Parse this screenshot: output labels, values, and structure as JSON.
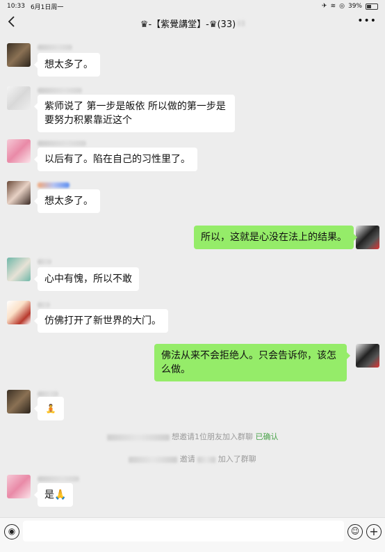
{
  "status_bar": {
    "time": "10:33",
    "date": "6月1日周一",
    "battery": "39%"
  },
  "nav": {
    "back_icon": "chevron-left-icon",
    "title": "♛-【紫覺講堂】-♛(33)",
    "more_icon": "more-icon"
  },
  "messages": [
    {
      "sender": "other",
      "text": "想太多了。"
    },
    {
      "sender": "other",
      "text": "紫师说了 第一步是皈依 所以做的第一步是要努力积累靠近这个"
    },
    {
      "sender": "other",
      "text": "以后有了。陷在自己的习性里了。"
    },
    {
      "sender": "other",
      "text": "想太多了。"
    },
    {
      "sender": "me",
      "text": "所以，这就是心没在法上的结果。"
    },
    {
      "sender": "other",
      "text": "心中有愧，所以不敢"
    },
    {
      "sender": "other",
      "text": "仿佛打开了新世界的大门。"
    },
    {
      "sender": "me",
      "text": "佛法从来不会拒绝人。只会告诉你，该怎么做。"
    },
    {
      "sender": "other",
      "text": "🧘"
    },
    {
      "sender": "other",
      "text": "是🙏"
    }
  ],
  "system_notices": [
    {
      "text": "想邀请1位朋友加入群聊",
      "action": "已确认"
    },
    {
      "prefix": "邀请",
      "text": "加入了群聊"
    }
  ],
  "input_bar": {
    "voice_icon": "voice-icon",
    "emoji_icon": "emoji-icon",
    "plus_icon": "plus-icon"
  },
  "colors": {
    "background": "#ededed",
    "my_bubble": "#95ec69",
    "other_bubble": "#ffffff",
    "confirm": "#4aa34a"
  }
}
